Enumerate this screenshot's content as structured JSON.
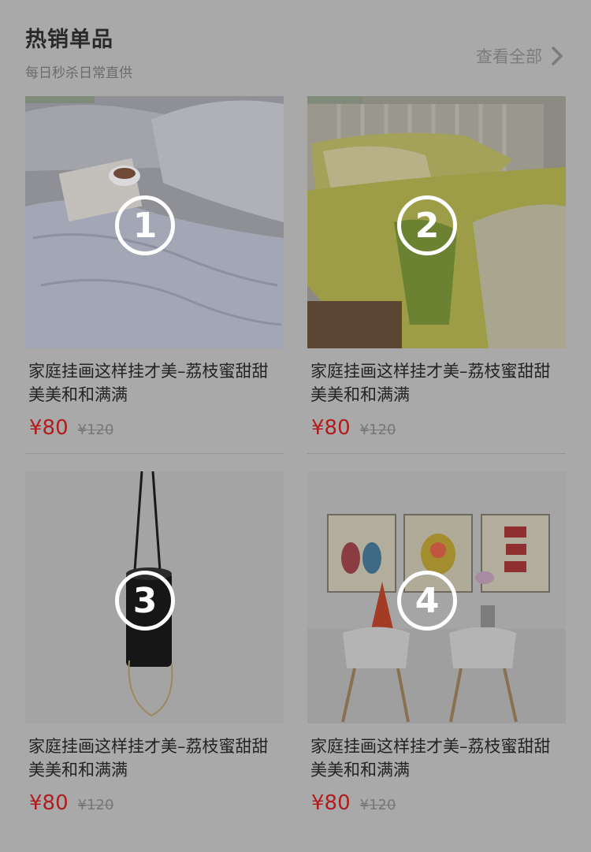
{
  "header": {
    "title": "热销单品",
    "subtitle": "每日秒杀日常直供",
    "see_all_label": "查看全部"
  },
  "products": [
    {
      "badge": "1",
      "name": "家庭挂画这样挂才美–荔枝蜜甜甜美美和和满满",
      "price": "¥80",
      "original_price": "¥120"
    },
    {
      "badge": "2",
      "name": "家庭挂画这样挂才美–荔枝蜜甜甜美美和和满满",
      "price": "¥80",
      "original_price": "¥120"
    },
    {
      "badge": "3",
      "name": "家庭挂画这样挂才美–荔枝蜜甜甜美美和和满满",
      "price": "¥80",
      "original_price": "¥120"
    },
    {
      "badge": "4",
      "name": "家庭挂画这样挂才美–荔枝蜜甜甜美美和和满满",
      "price": "¥80",
      "original_price": "¥120"
    }
  ],
  "colors": {
    "page_overlay": "#a9a9a9",
    "price_red": "#b11d1d"
  }
}
